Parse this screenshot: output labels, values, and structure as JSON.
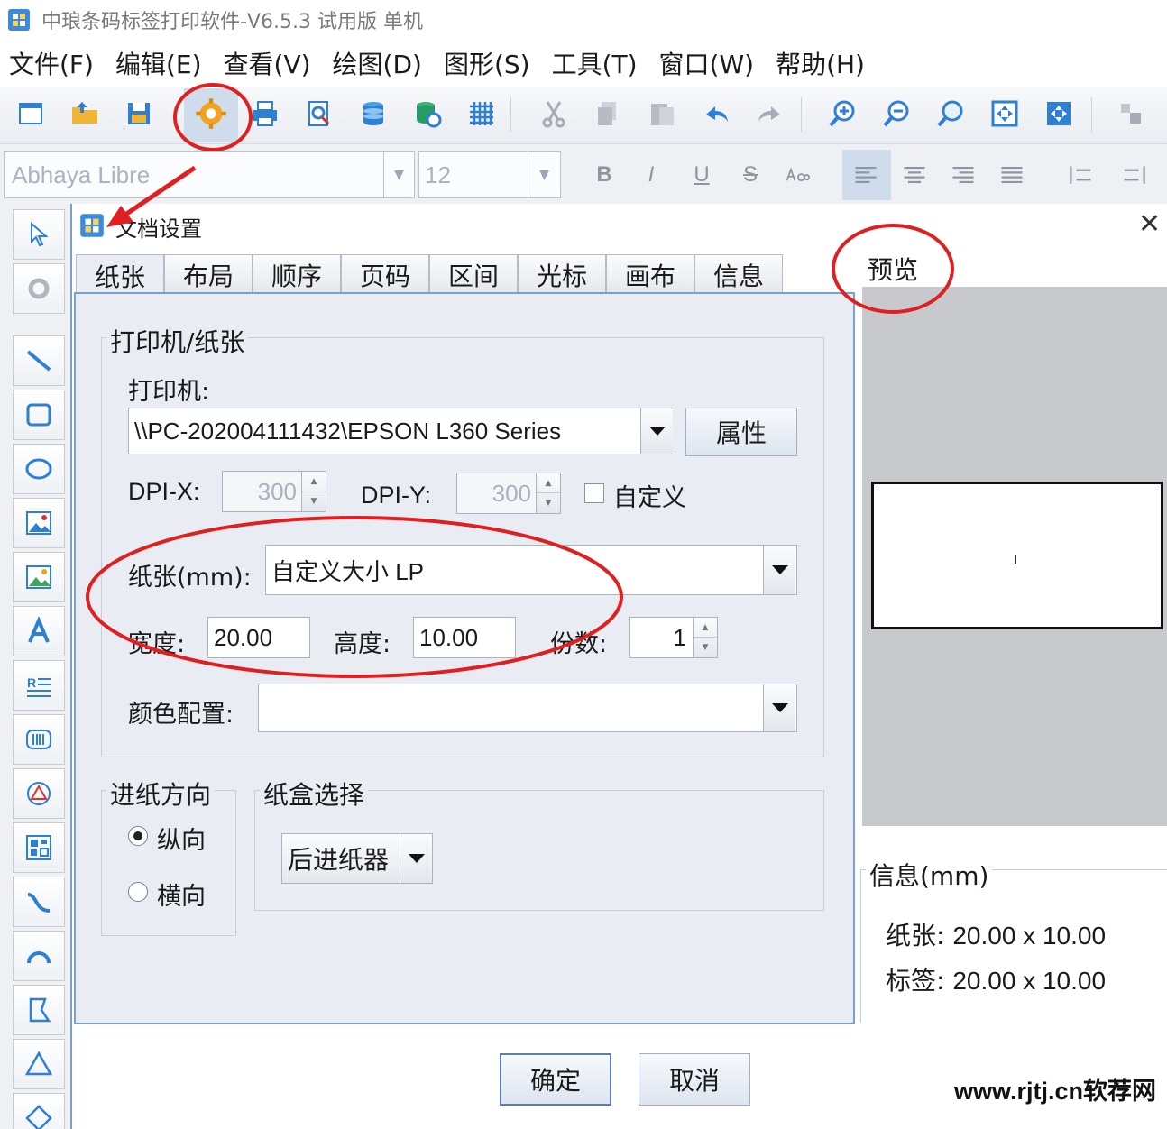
{
  "window": {
    "title": "中琅条码标签打印软件-V6.5.3 试用版 单机"
  },
  "menu": [
    "文件(F)",
    "编辑(E)",
    "查看(V)",
    "绘图(D)",
    "图形(S)",
    "工具(T)",
    "窗口(W)",
    "帮助(H)"
  ],
  "toolbar": {
    "icons": [
      "new-document-icon",
      "open-folder-icon",
      "save-icon",
      "document-settings-gear-icon",
      "print-icon",
      "print-preview-icon",
      "database-icon",
      "database-settings-icon",
      "grid-icon",
      "cut-icon",
      "copy-icon",
      "paste-icon",
      "undo-icon",
      "redo-icon",
      "zoom-in-icon",
      "zoom-out-icon",
      "zoom-actual-icon",
      "fit-page-icon",
      "fit-width-icon",
      "resize-icon"
    ]
  },
  "format": {
    "font_family": "Abhaya Libre",
    "font_size": "12",
    "style_buttons": [
      "B",
      "I",
      "U",
      "S"
    ]
  },
  "dialog": {
    "title": "文档设置",
    "tabs": [
      "纸张",
      "布局",
      "顺序",
      "页码",
      "区间",
      "光标",
      "画布",
      "信息"
    ],
    "active_tab": "纸张",
    "printer_group": "打印机/纸张",
    "printer_label": "打印机:",
    "printer_value": "\\\\PC-202004111432\\EPSON L360 Series",
    "properties_button": "属性",
    "dpix_label": "DPI-X:",
    "dpix_value": "300",
    "dpiy_label": "DPI-Y:",
    "dpiy_value": "300",
    "custom_label": "自定义",
    "paper_label": "纸张(mm):",
    "paper_value": "自定义大小 LP",
    "width_label": "宽度:",
    "width_value": "20.00",
    "height_label": "高度:",
    "height_value": "10.00",
    "copies_label": "份数:",
    "copies_value": "1",
    "color_label": "颜色配置:",
    "color_value": "",
    "feed_group": "进纸方向",
    "portrait_label": "纵向",
    "landscape_label": "横向",
    "tray_group": "纸盒选择",
    "tray_value": "后进纸器",
    "preview_label": "预览",
    "info_group": "信息(mm)",
    "info_paper_label": "纸张:",
    "info_paper_value": "20.00 x 10.00",
    "info_label_label": "标签:",
    "info_label_value": "20.00 x 10.00",
    "ok_button": "确定",
    "cancel_button": "取消"
  },
  "watermark": "www.rjtj.cn软荐网",
  "colors": {
    "accent_blue": "#2e7fd6",
    "annotation_red": "#e02020",
    "preview_gray": "#c7c9cc"
  }
}
